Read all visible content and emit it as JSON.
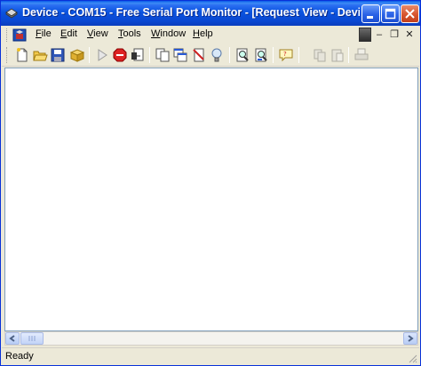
{
  "window": {
    "title": "Device - COM15 - Free Serial Port Monitor - [Request View - Device..."
  },
  "menubar": {
    "items": [
      {
        "pre": "",
        "mnemonic": "F",
        "rest": "ile"
      },
      {
        "pre": "",
        "mnemonic": "E",
        "rest": "dit"
      },
      {
        "pre": "",
        "mnemonic": "V",
        "rest": "iew"
      },
      {
        "pre": "",
        "mnemonic": "T",
        "rest": "ools"
      },
      {
        "pre": "",
        "mnemonic": "W",
        "rest": "indow"
      },
      {
        "pre": "",
        "mnemonic": "H",
        "rest": "elp"
      }
    ],
    "mdi_minimize": "–",
    "mdi_restore": "❐",
    "mdi_close": "✕"
  },
  "toolbar": {
    "icons": [
      "new-doc-icon",
      "open-folder-icon",
      "save-icon",
      "package-icon",
      "play-icon",
      "stop-icon",
      "export-icon",
      "copy-icon",
      "tile-icon",
      "clear-icon",
      "bulb-icon",
      "find-icon",
      "find-next-icon",
      "comment-icon",
      "disabled-copy-icon",
      "disabled-paste-icon",
      "disabled-print-icon"
    ]
  },
  "statusbar": {
    "text": "Ready"
  },
  "colors": {
    "titlebar": "#0a53df",
    "window_bg": "#ece9d8",
    "content_bg": "#ffffff"
  }
}
